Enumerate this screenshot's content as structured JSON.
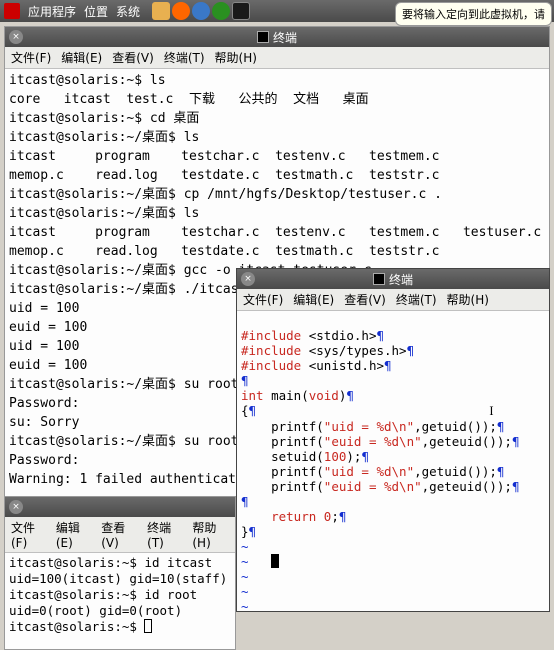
{
  "tooltip": "要将输入定向到此虚拟机，请",
  "taskbar": {
    "apps": "应用程序",
    "places": "位置",
    "system": "系统"
  },
  "menus": {
    "file": "文件(F)",
    "edit": "编辑(E)",
    "view": "查看(V)",
    "terminal": "终端(T)",
    "help": "帮助(H)"
  },
  "win1": {
    "title": "终端",
    "body": "itcast@solaris:~$ ls\ncore   itcast  test.c  下载   公共的  文档   桌面\nitcast@solaris:~$ cd 桌面\nitcast@solaris:~/桌面$ ls\nitcast     program    testchar.c  testenv.c   testmem.c\nmemop.c    read.log   testdate.c  testmath.c  teststr.c\nitcast@solaris:~/桌面$ cp /mnt/hgfs/Desktop/testuser.c .\nitcast@solaris:~/桌面$ ls\nitcast     program    testchar.c  testenv.c   testmem.c   testuser.c\nmemop.c    read.log   testdate.c  testmath.c  teststr.c\nitcast@solaris:~/桌面$ gcc -o itcast testuser.c\nitcast@solaris:~/桌面$ ./itcas\nuid = 100\neuid = 100\nuid = 100\neuid = 100\nitcast@solaris:~/桌面$ su root\nPassword:\nsu: Sorry\nitcast@solaris:~/桌面$ su root\nPassword:\nWarning: 1 failed authenticati"
  },
  "win2": {
    "body": "itcast@solaris:~$ id itcast\nuid=100(itcast) gid=10(staff)\nitcast@solaris:~$ id root\nuid=0(root) gid=0(root)\nitcast@solaris:~$ "
  },
  "win3": {
    "title": "终端",
    "code": {
      "l1a": "#include",
      "l1b": " <stdio.h>",
      "l2a": "#include",
      "l2b": " <sys/types.h>",
      "l3a": "#include",
      "l3b": " <unistd.h>",
      "blank": "",
      "l5a": "int",
      "l5b": " main(",
      "l5c": "void",
      "l5d": ")",
      "l6": "{",
      "l7a": "    printf(",
      "l7b": "\"uid = %d\\n\"",
      "l7c": ",getuid());",
      "l8a": "    printf(",
      "l8b": "\"euid = %d\\n\"",
      "l8c": ",geteuid());",
      "l9a": "    setuid(",
      "l9b": "100",
      "l9c": ");",
      "l10a": "    printf(",
      "l10b": "\"uid = %d\\n\"",
      "l10c": ",getuid());",
      "l11a": "    printf(",
      "l11b": "\"euid = %d\\n\"",
      "l11c": ",geteuid());",
      "l13a": "    return",
      "l13b": " 0",
      "l13c": ";",
      "l14": "}",
      "tilde": "~",
      "pilcrow": "¶"
    }
  }
}
